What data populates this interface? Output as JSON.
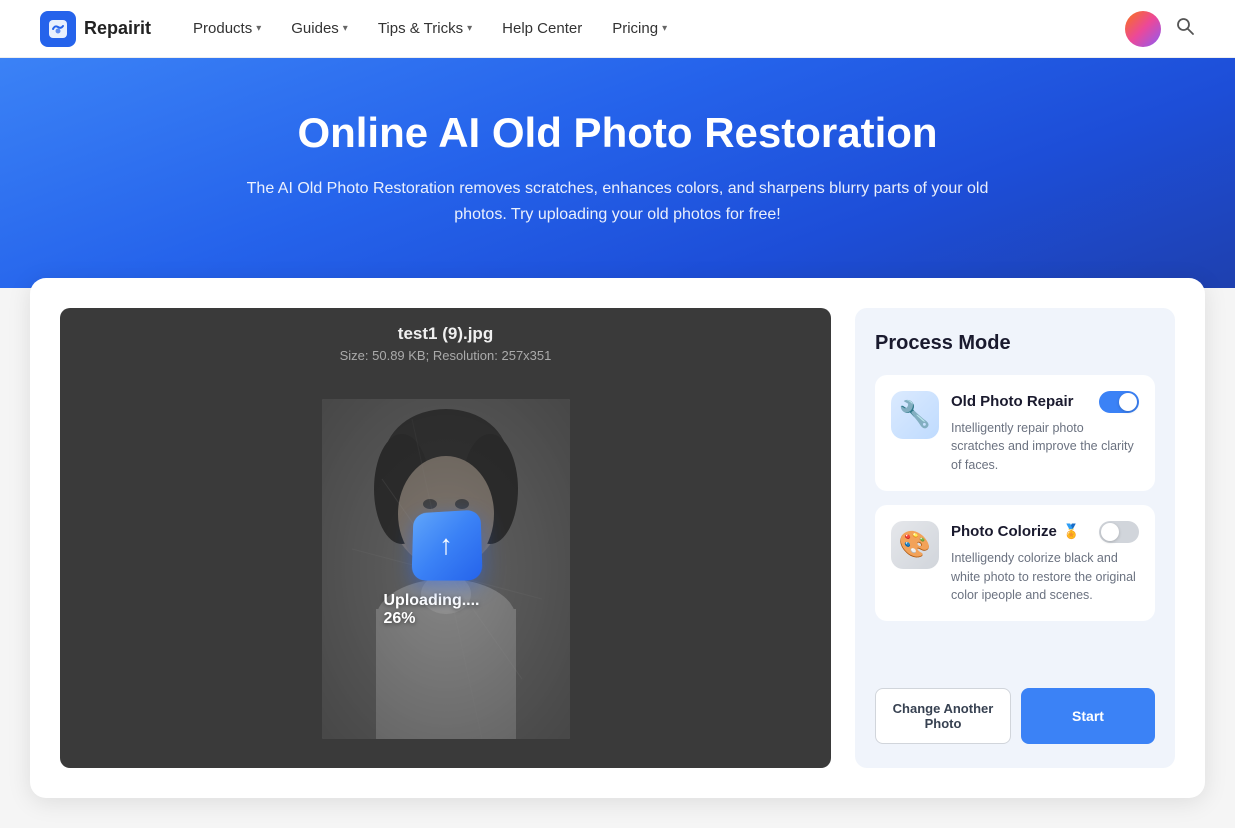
{
  "nav": {
    "logo_text": "Repairit",
    "items": [
      {
        "label": "Products",
        "has_chevron": true
      },
      {
        "label": "Guides",
        "has_chevron": true
      },
      {
        "label": "Tips & Tricks",
        "has_chevron": true
      },
      {
        "label": "Help Center",
        "has_chevron": false
      },
      {
        "label": "Pricing",
        "has_chevron": true
      }
    ]
  },
  "hero": {
    "title": "Online AI Old Photo Restoration",
    "subtitle": "The AI Old Photo Restoration removes scratches, enhances colors, and sharpens blurry parts of your old photos. Try uploading your old photos for free!"
  },
  "photo_area": {
    "filename": "test1 (9).jpg",
    "meta": "Size: 50.89 KB; Resolution: 257x351",
    "upload_text": "Uploading.... 26%"
  },
  "process_panel": {
    "title": "Process Mode",
    "repair": {
      "label": "Old Photo Repair",
      "desc": "Intelligently repair photo scratches and improve the clarity of faces.",
      "enabled": true
    },
    "colorize": {
      "label": "Photo Colorize",
      "desc": "Intelligendy colorize black and white photo to restore the original color ipeople and scenes.",
      "enabled": false,
      "badge": "🏅"
    },
    "btn_change": "Change Another Photo",
    "btn_start": "Start"
  }
}
